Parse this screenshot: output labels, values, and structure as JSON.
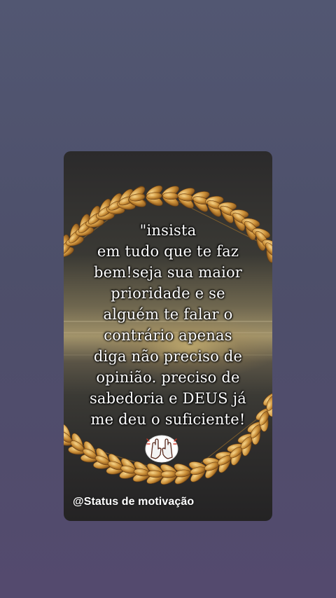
{
  "story": {
    "quote_lines": [
      "\"insista",
      "em tudo que te faz",
      " bem!seja sua maior",
      "prioridade e se",
      "alguém te falar o",
      "contrário apenas",
      "diga não preciso de",
      "opinião. preciso de",
      "sabedoria e DEUS já",
      "me deu o suficiente!"
    ],
    "emoji": "raising-hands-icon",
    "watermark": "@Status de motivação"
  },
  "colors": {
    "background": "#4f5270",
    "wreath_gold": "#c8913a",
    "text": "#ffffff"
  }
}
